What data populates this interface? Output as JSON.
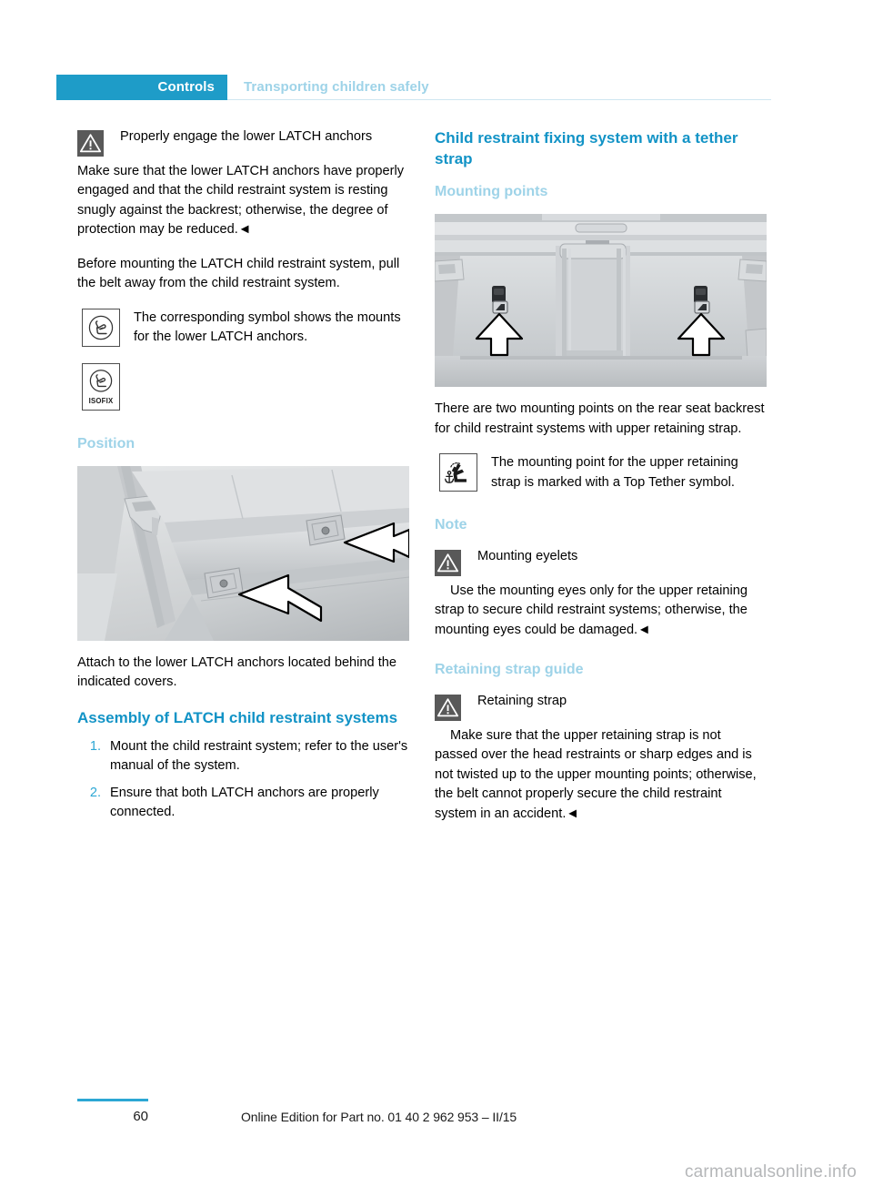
{
  "header": {
    "tab_label": "Controls",
    "section_label": "Transporting children safely"
  },
  "left_column": {
    "warning_1": {
      "icon": "warning-triangle-icon",
      "title": "Properly engage the lower LATCH anchors",
      "body": "Make sure that the lower LATCH anchors have properly engaged and that the child restraint system is resting snugly against the backrest; otherwise, the degree of protection may be reduced.◄"
    },
    "paragraph_1": "Before mounting the LATCH child restraint system, pull the belt away from the child restraint system.",
    "symbol_row": {
      "icon": "child-seat-symbol-icon",
      "caption": "The corresponding symbol shows the mounts for the lower LATCH anchors."
    },
    "symbol_isofix": {
      "icon": "isofix-child-seat-symbol-icon",
      "label": "ISOFIX"
    },
    "heading_position": "Position",
    "figure_position": {
      "name": "rear-seat-latch-anchors-photo",
      "alt": "Rear seat bench with two white arrows pointing to the lower LATCH anchor covers"
    },
    "paragraph_2": "Attach to the lower LATCH anchors located behind the indicated covers.",
    "heading_assembly": "Assembly of LATCH child restraint systems",
    "steps": [
      {
        "num": "1.",
        "text": "Mount the child restraint system; refer to the user's manual of the system."
      },
      {
        "num": "2.",
        "text": "Ensure that both LATCH anchors are properly connected."
      }
    ]
  },
  "right_column": {
    "heading_main": "Child restraint fixing system with a tether strap",
    "heading_mounting_points": "Mounting points",
    "figure_mounting": {
      "name": "rear-shelf-tether-mounting-points-photo",
      "alt": "View of rear parcel shelf with two white arrows pointing up at the tether anchor points"
    },
    "paragraph_1": "There are two mounting points on the rear seat backrest for child restraint systems with upper retaining strap.",
    "symbol_row": {
      "icon": "top-tether-symbol-icon",
      "caption": "The mounting point for the upper retaining strap is marked with a Top Tether symbol."
    },
    "heading_note": "Note",
    "warning_note": {
      "icon": "warning-triangle-icon",
      "title": "Mounting eyelets",
      "body": "Use the mounting eyes only for the upper retaining strap to secure child restraint systems; otherwise, the mounting eyes could be damaged.◄"
    },
    "heading_retaining_strap_guide": "Retaining strap guide",
    "warning_strap": {
      "icon": "warning-triangle-icon",
      "title": "Retaining strap",
      "body": "Make sure that the upper retaining strap is not passed over the head restraints or sharp edges and is not twisted up to the upper mounting points; otherwise, the belt cannot properly secure the child restraint system in an accident.◄"
    }
  },
  "footer": {
    "page_number": "60",
    "edition_text": "Online Edition for Part no. 01 40 2 962 953 – II/15",
    "watermark": "carmanualsonline.info"
  },
  "colors": {
    "tab_background": "#1e9cc8",
    "heading_primary": "#1293c6",
    "heading_secondary": "#9ed3e8",
    "list_number": "#2ca7d4",
    "warning_icon_bg": "#595959",
    "footer_rule": "#2ca7d4"
  }
}
